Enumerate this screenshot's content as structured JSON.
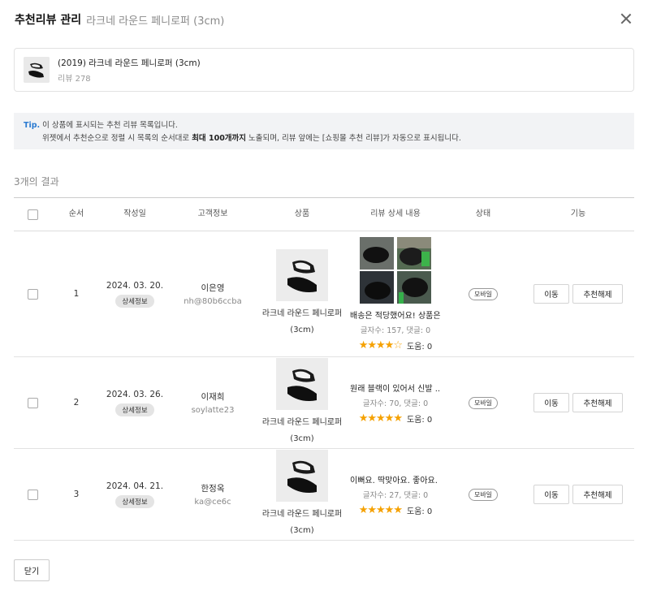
{
  "header": {
    "title": "추천리뷰 관리",
    "subtitle": "라크네 라운드 페니로퍼 (3cm)"
  },
  "product": {
    "name": "(2019) 라크네 라운드 페니로퍼 (3cm)",
    "review_count": "리뷰 278"
  },
  "tip": {
    "label": "Tip.",
    "line1": " 이 상품에 표시되는 추천 리뷰 목록입니다.",
    "line2_a": "위젯에서 추천순으로 정렬 시 목록의 순서대로 ",
    "line2_bold": "최대 100개까지",
    "line2_b": " 노출되며, 리뷰 앞에는 [쇼핑몰 추천 리뷰]가 자동으로 표시됩니다."
  },
  "results": "3개의 결과",
  "columns": {
    "order": "순서",
    "date": "작성일",
    "customer": "고객정보",
    "product": "상품",
    "review": "리뷰 상세 내용",
    "status": "상태",
    "actions": "기능"
  },
  "rows": [
    {
      "order": "1",
      "date": "2024. 03. 20.",
      "detail": "상세정보",
      "customer_name": "이은영",
      "customer_id": "nh@80b6ccba",
      "product_name": "라크네 라운드 페니로퍼 (3cm)",
      "review_text": "배송은 적당했어요! 상품은...",
      "review_meta": "글자수: 157, 댓글: 0",
      "rating": 4,
      "helpful": "도움: 0",
      "status": "모바일",
      "move": "이동",
      "unrecommend": "추천해제"
    },
    {
      "order": "2",
      "date": "2024. 03. 26.",
      "detail": "상세정보",
      "customer_name": "이재희",
      "customer_id": "soylatte23",
      "product_name": "라크네 라운드 페니로퍼 (3cm)",
      "review_text": "원래 블랙이 있어서 신발 ...",
      "review_meta": "글자수: 70, 댓글: 0",
      "rating": 5,
      "helpful": "도움: 0",
      "status": "모바일",
      "move": "이동",
      "unrecommend": "추천해제"
    },
    {
      "order": "3",
      "date": "2024. 04. 21.",
      "detail": "상세정보",
      "customer_name": "한정옥",
      "customer_id": "ka@ce6c",
      "product_name": "라크네 라운드 페니로퍼 (3cm)",
      "review_text": "이뻐요. 딱맞아요. 좋아요. ...",
      "review_meta": "글자수: 27, 댓글: 0",
      "rating": 5,
      "helpful": "도움: 0",
      "status": "모바일",
      "move": "이동",
      "unrecommend": "추천해제"
    }
  ],
  "footer": {
    "close_label": "닫기"
  },
  "icons": {
    "close": "close-icon",
    "star": "star-icon"
  },
  "colors": {
    "accent": "#2b7bd1",
    "star": "#f5a100"
  }
}
